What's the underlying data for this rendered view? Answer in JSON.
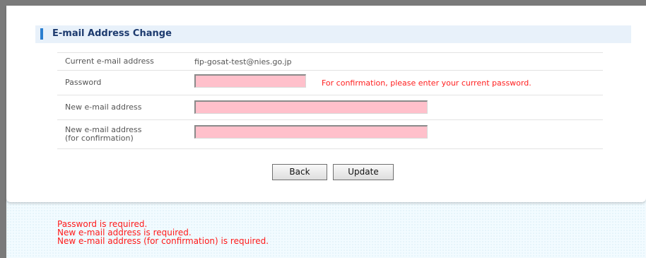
{
  "section_title": "E-mail Address Change",
  "form": {
    "current_email_label": "Current e-mail address",
    "current_email_value": "fip-gosat-test@nies.go.jp",
    "password_label": "Password",
    "password_value": "",
    "password_hint": "For confirmation, please enter your current password.",
    "new_email_label": "New e-mail address",
    "new_email_value": "",
    "confirm_email_label_line1": "New e-mail address",
    "confirm_email_label_line2": "(for confirmation)",
    "confirm_email_value": ""
  },
  "buttons": {
    "back": "Back",
    "update": "Update"
  },
  "errors": [
    "Password is required.",
    "New e-mail address is required.",
    "New e-mail address (for confirmation) is required."
  ],
  "colors": {
    "input_error_bg": "#ffc0cb",
    "error_text": "#ff1a1a",
    "title_marker": "#2a7ed0",
    "title_text": "#1c3a6e"
  }
}
